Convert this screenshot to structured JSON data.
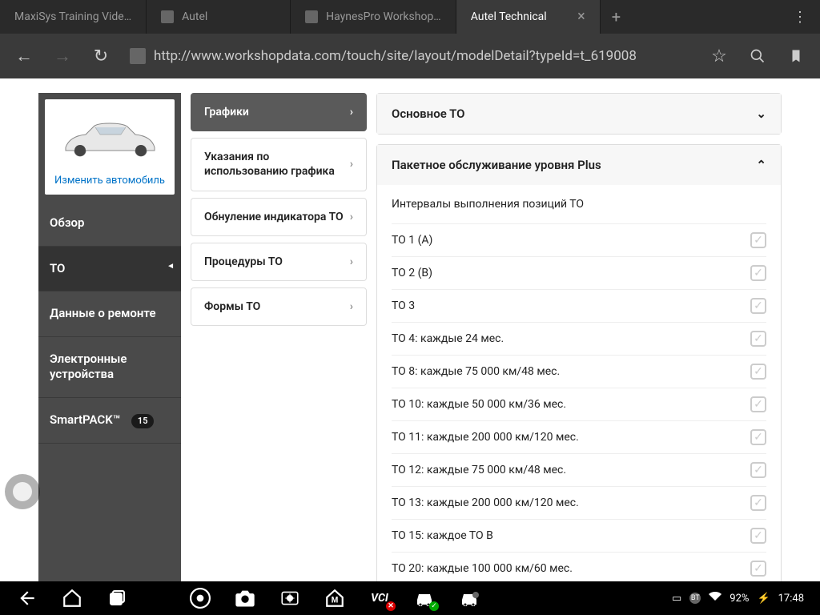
{
  "browser": {
    "tabs": [
      {
        "title": "MaxiSys Training Vide…"
      },
      {
        "title": "Autel"
      },
      {
        "title": "HaynesPro Workshop…"
      },
      {
        "title": "Autel Technical"
      }
    ],
    "url": "http://www.workshopdata.com/touch/site/layout/modelDetail?typeId=t_619008"
  },
  "sidebar": {
    "change_car": "Изменить автомобиль",
    "items": [
      {
        "label": "Обзор"
      },
      {
        "label": "ТО"
      },
      {
        "label": "Данные о ремонте"
      },
      {
        "label": "Электронные устройства"
      },
      {
        "label": "SmartPACK™",
        "badge": "15"
      }
    ]
  },
  "middle_menu": [
    "Графики",
    "Указания по использованию графика",
    "Обнуление индикатора ТО",
    "Процедуры ТО",
    "Формы ТО"
  ],
  "main": {
    "accordion1": "Основное ТО",
    "accordion2": "Пакетное обслуживание уровня Plus",
    "subheader": "Интервалы выполнения позиций ТО",
    "items": [
      "TO 1 (A)",
      "TO 2 (B)",
      "TO 3",
      "TO 4: каждые 24 мес.",
      "TO 8: каждые 75 000 км/48 мес.",
      "TO 10: каждые 50 000 км/36 мес.",
      "TO 11: каждые 200 000 км/120 мес.",
      "TO 12: каждые 75 000 км/48 мес.",
      "TO 13: каждые 200 000 км/120 мес.",
      "TO 15: каждое ТО B",
      "TO 20: каждые 100 000 км/60 мес."
    ]
  },
  "status": {
    "battery": "92%",
    "time": "17:48"
  }
}
